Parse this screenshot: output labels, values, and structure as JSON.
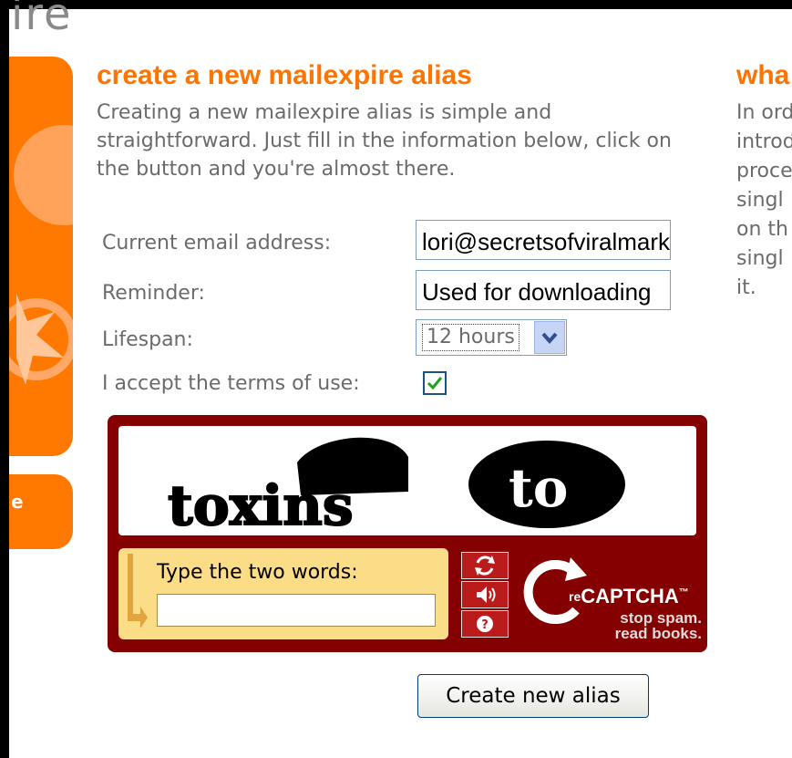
{
  "header": {
    "logo_fragment": "ire"
  },
  "sidebar": {
    "button_label": "e"
  },
  "main": {
    "title": "create a new mailexpire alias",
    "intro_lines": [
      "Creating a new mailexpire alias is simple and",
      "straightforward. Just fill in the information below, click on",
      "the button and you're almost there."
    ]
  },
  "side_column": {
    "title": "wha",
    "lines": [
      "In ord",
      "introd",
      "proce",
      "singl",
      "on th",
      "singl",
      "it."
    ]
  },
  "form": {
    "email": {
      "label": "Current email address:",
      "value": "lori@secretsofviralmarketing.com"
    },
    "reminder": {
      "label": "Reminder:",
      "value": "Used for downloading"
    },
    "lifespan": {
      "label": "Lifespan:",
      "value": "12 hours"
    },
    "terms": {
      "label": "I accept the terms of use:",
      "checked": true
    }
  },
  "captcha": {
    "words": [
      "toxins",
      "to"
    ],
    "entry_label": "Type the two words:",
    "input_value": "",
    "buttons": [
      "refresh-icon",
      "audio-icon",
      "help-icon"
    ],
    "brand": {
      "prefix": "re",
      "name": "CAPTCHA",
      "trademark": "™"
    },
    "tagline": [
      "stop spam.",
      "read books."
    ]
  },
  "submit": {
    "label": "Create new alias"
  },
  "colors": {
    "accent": "#ff7300",
    "sidebar": "#ff7800",
    "body_text": "#6b6b6b",
    "captcha_frame": "#850000",
    "captcha_entry": "#fbdc87"
  }
}
